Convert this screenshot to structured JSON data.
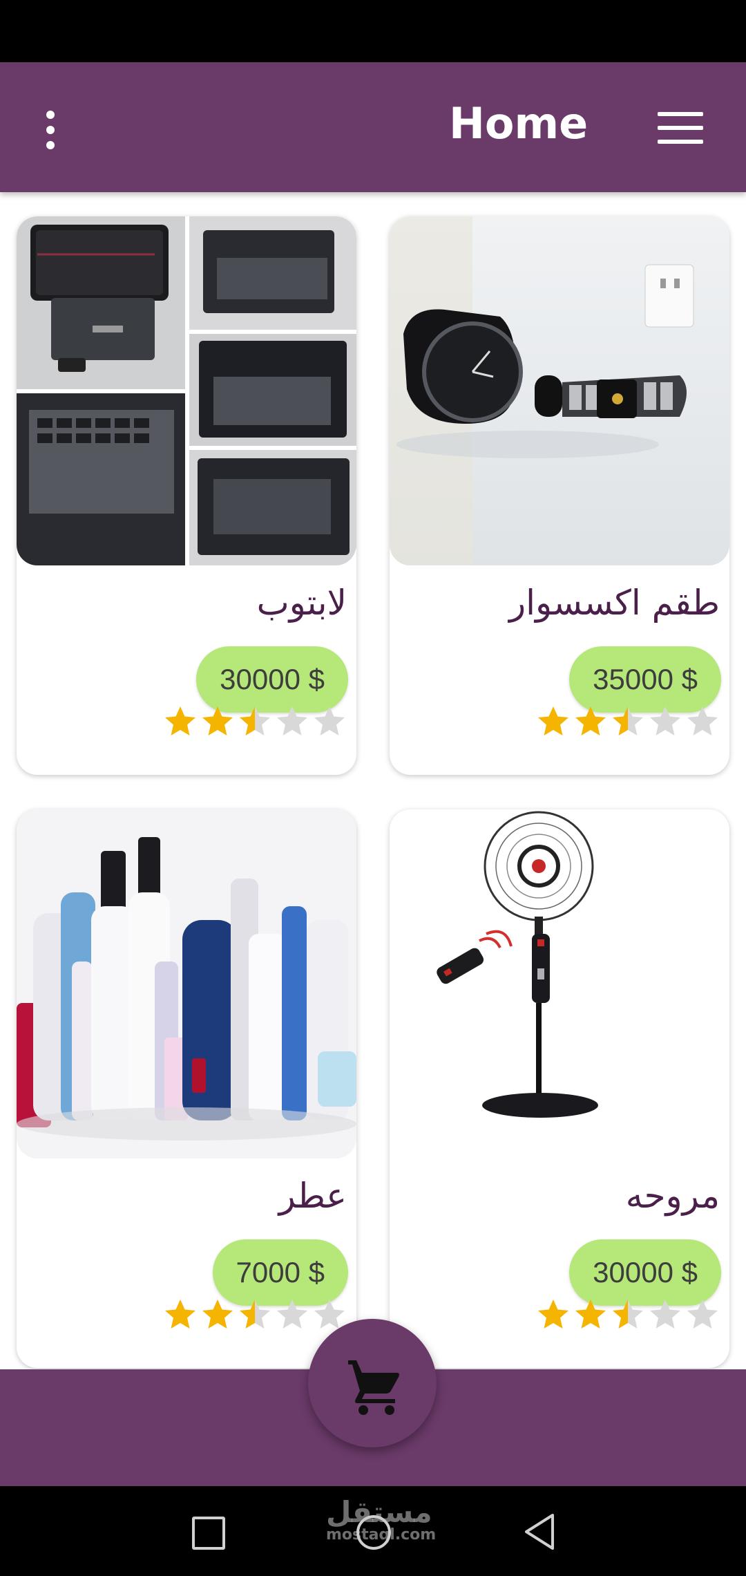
{
  "app_bar": {
    "title": "Home",
    "more_icon": "more-vert-icon",
    "menu_icon": "menu-icon",
    "color": "#6a3a68"
  },
  "products": [
    {
      "name": "لابتوب",
      "price": "30000 $",
      "rating": 2.5,
      "image": "laptop-collage"
    },
    {
      "name": "طقم اكسسوار",
      "price": "35000 $",
      "rating": 2.5,
      "image": "watches"
    },
    {
      "name": "عطر",
      "price": "7000 $",
      "rating": 2.5,
      "image": "perfume-bottles"
    },
    {
      "name": "مروحه",
      "price": "30000 $",
      "rating": 2.5,
      "image": "stand-fan"
    }
  ],
  "fab": {
    "icon": "cart-icon"
  },
  "nav": {
    "items": [
      "recent-apps-icon",
      "home-icon",
      "back-icon"
    ]
  },
  "watermark": {
    "text": "مستقل",
    "sub": "mostaql.com"
  },
  "colors": {
    "primary": "#6a3a68",
    "price_bg": "#b5e878",
    "star": "#f5b400",
    "star_off": "#d8d8d8"
  }
}
